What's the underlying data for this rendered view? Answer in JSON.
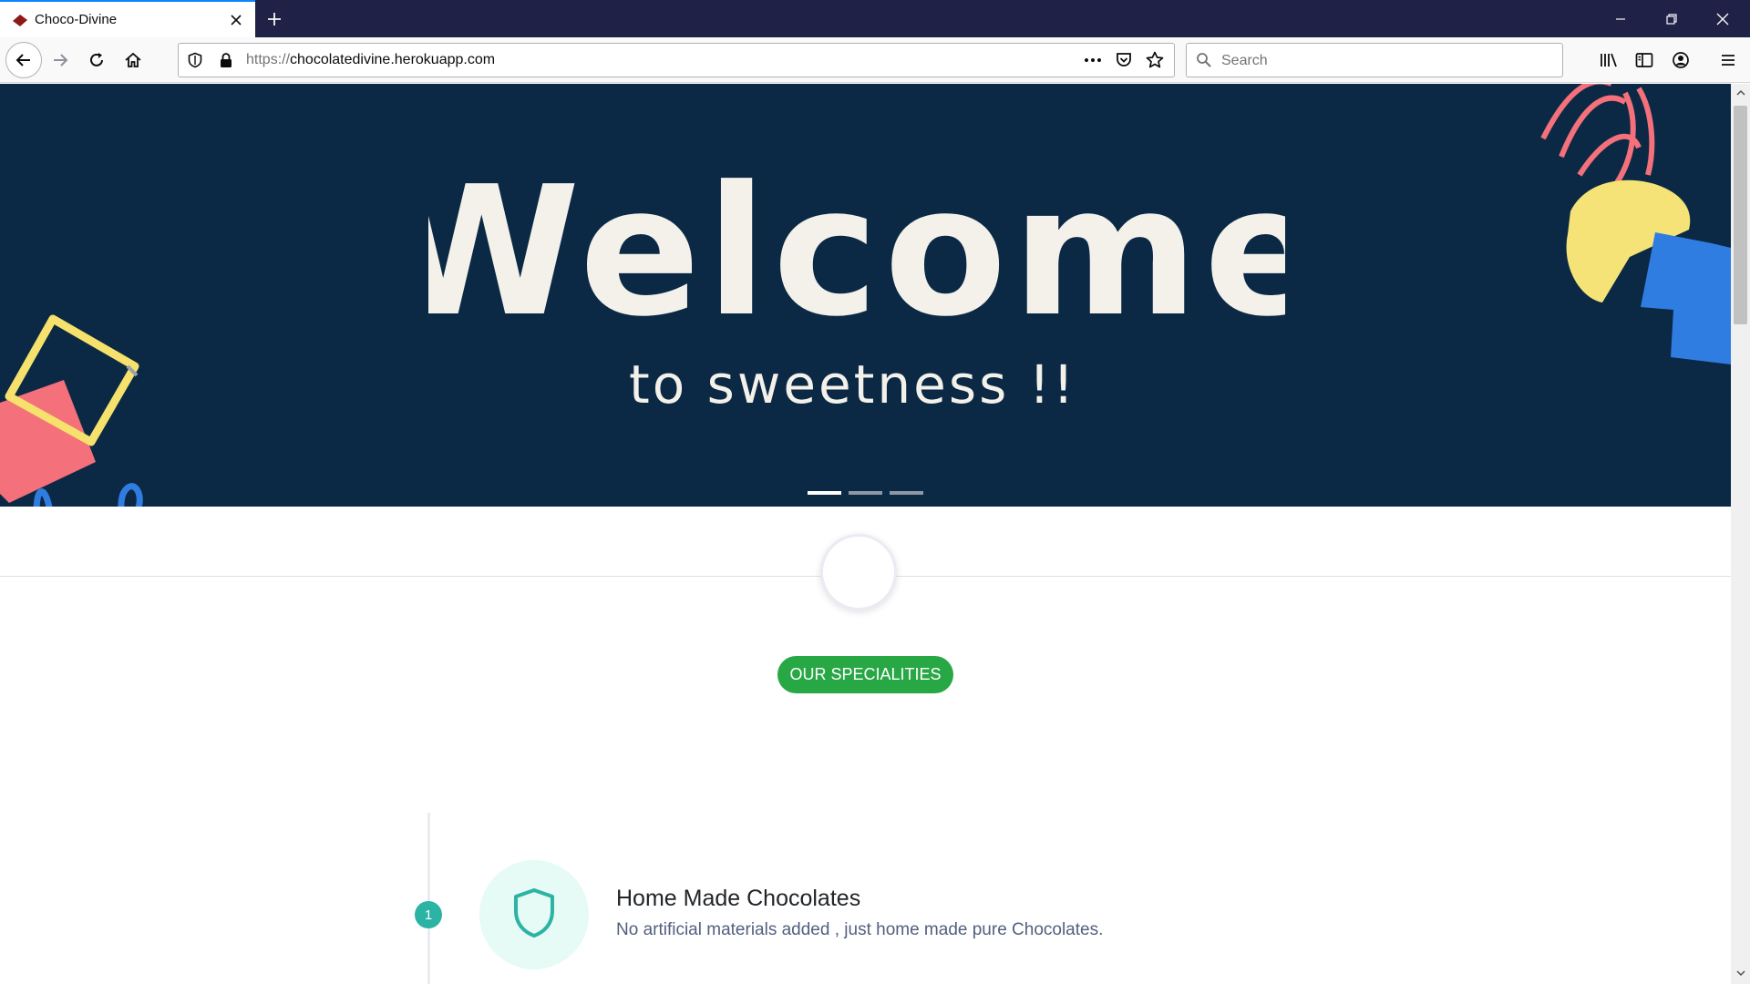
{
  "browser": {
    "tab": {
      "title": "Choco-Divine",
      "favicon": "chocolate-icon"
    },
    "url": {
      "scheme": "https://",
      "host": "chocolatedivine.herokuapp.com"
    },
    "search": {
      "placeholder": "Search"
    },
    "icons": [
      "back-arrow-icon",
      "forward-arrow-icon",
      "reload-icon",
      "home-icon",
      "shield-icon",
      "lock-icon",
      "more-icon",
      "pocket-icon",
      "star-icon",
      "search-icon",
      "library-icon",
      "sidebar-icon",
      "account-icon",
      "menu-icon",
      "minimize-icon",
      "restore-icon",
      "close-icon",
      "plus-icon"
    ]
  },
  "hero": {
    "title": "Welcome",
    "subtitle": "to sweetness !!",
    "slides": 3,
    "active_slide": 1,
    "background": "#0b2945"
  },
  "specialities": {
    "label": "OUR SPECIALITIES",
    "color": "#28a745"
  },
  "features": [
    {
      "number": "1",
      "title": "Home Made Chocolates",
      "description": "No artificial materials added , just home made pure Chocolates.",
      "icon": "shield-icon"
    }
  ]
}
